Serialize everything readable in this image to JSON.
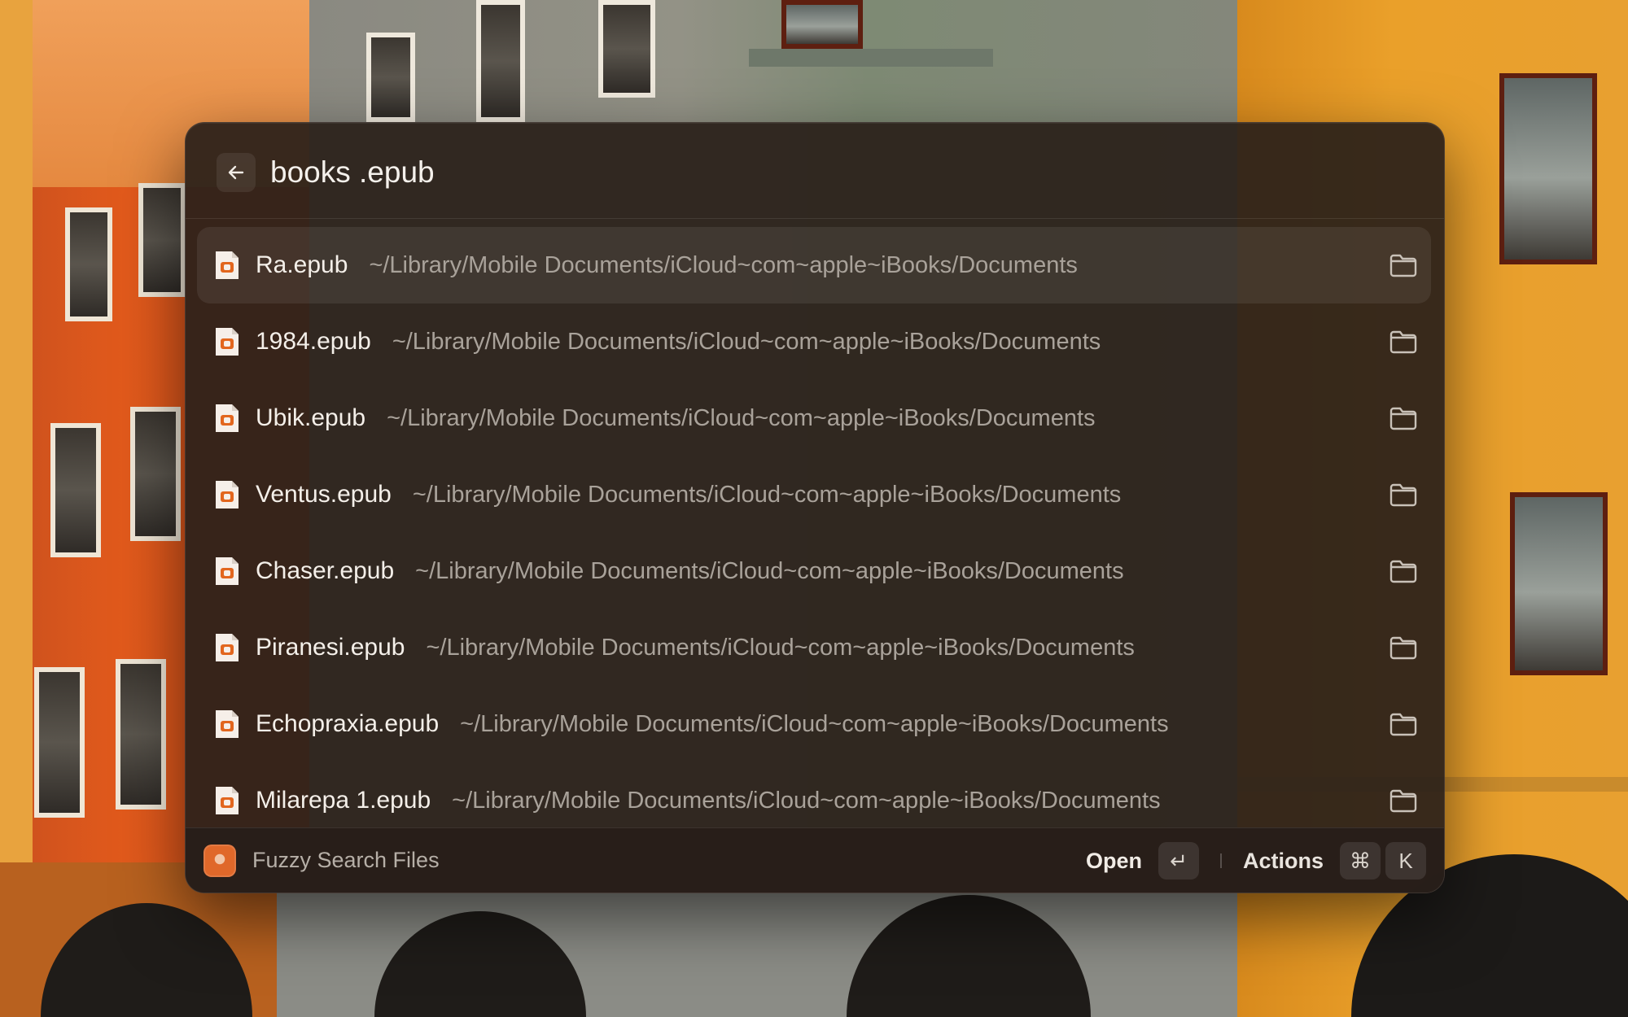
{
  "search": {
    "query": "books .epub",
    "back_icon": "arrow-left-icon"
  },
  "results": [
    {
      "name": "Ra.epub",
      "path": "~/Library/Mobile Documents/iCloud~com~apple~iBooks/Documents",
      "selected": true
    },
    {
      "name": "1984.epub",
      "path": "~/Library/Mobile Documents/iCloud~com~apple~iBooks/Documents",
      "selected": false
    },
    {
      "name": "Ubik.epub",
      "path": "~/Library/Mobile Documents/iCloud~com~apple~iBooks/Documents",
      "selected": false
    },
    {
      "name": "Ventus.epub",
      "path": "~/Library/Mobile Documents/iCloud~com~apple~iBooks/Documents",
      "selected": false
    },
    {
      "name": "Chaser.epub",
      "path": "~/Library/Mobile Documents/iCloud~com~apple~iBooks/Documents",
      "selected": false
    },
    {
      "name": "Piranesi.epub",
      "path": "~/Library/Mobile Documents/iCloud~com~apple~iBooks/Documents",
      "selected": false
    },
    {
      "name": "Echopraxia.epub",
      "path": "~/Library/Mobile Documents/iCloud~com~apple~iBooks/Documents",
      "selected": false
    },
    {
      "name": "Milarepa 1.epub",
      "path": "~/Library/Mobile Documents/iCloud~com~apple~iBooks/Documents",
      "selected": false
    }
  ],
  "footer": {
    "command_title": "Fuzzy Search Files",
    "primary_action": "Open",
    "primary_shortcut": "↵",
    "actions_label": "Actions",
    "actions_shortcut_mod": "⌘",
    "actions_shortcut_key": "K"
  },
  "colors": {
    "accent": "#e0682a",
    "panel_bg": "#2a201a",
    "text_primary": "#f4efe9",
    "text_secondary": "#a9a29a"
  }
}
